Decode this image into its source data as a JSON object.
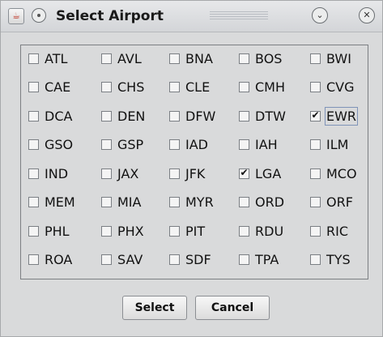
{
  "window": {
    "title": "Select Airport",
    "app_icon_glyph": "☕",
    "minimize_glyph": "⌄",
    "close_glyph": "✕"
  },
  "airports": [
    {
      "code": "ATL",
      "checked": false
    },
    {
      "code": "AVL",
      "checked": false
    },
    {
      "code": "BNA",
      "checked": false
    },
    {
      "code": "BOS",
      "checked": false
    },
    {
      "code": "BWI",
      "checked": false
    },
    {
      "code": "CAE",
      "checked": false
    },
    {
      "code": "CHS",
      "checked": false
    },
    {
      "code": "CLE",
      "checked": false
    },
    {
      "code": "CMH",
      "checked": false
    },
    {
      "code": "CVG",
      "checked": false
    },
    {
      "code": "DCA",
      "checked": false
    },
    {
      "code": "DEN",
      "checked": false
    },
    {
      "code": "DFW",
      "checked": false
    },
    {
      "code": "DTW",
      "checked": false
    },
    {
      "code": "EWR",
      "checked": true,
      "focused": true
    },
    {
      "code": "GSO",
      "checked": false
    },
    {
      "code": "GSP",
      "checked": false
    },
    {
      "code": "IAD",
      "checked": false
    },
    {
      "code": "IAH",
      "checked": false
    },
    {
      "code": "ILM",
      "checked": false
    },
    {
      "code": "IND",
      "checked": false
    },
    {
      "code": "JAX",
      "checked": false
    },
    {
      "code": "JFK",
      "checked": false
    },
    {
      "code": "LGA",
      "checked": true
    },
    {
      "code": "MCO",
      "checked": false
    },
    {
      "code": "MEM",
      "checked": false
    },
    {
      "code": "MIA",
      "checked": false
    },
    {
      "code": "MYR",
      "checked": false
    },
    {
      "code": "ORD",
      "checked": false
    },
    {
      "code": "ORF",
      "checked": false
    },
    {
      "code": "PHL",
      "checked": false
    },
    {
      "code": "PHX",
      "checked": false
    },
    {
      "code": "PIT",
      "checked": false
    },
    {
      "code": "RDU",
      "checked": false
    },
    {
      "code": "RIC",
      "checked": false
    },
    {
      "code": "ROA",
      "checked": false
    },
    {
      "code": "SAV",
      "checked": false
    },
    {
      "code": "SDF",
      "checked": false
    },
    {
      "code": "TPA",
      "checked": false
    },
    {
      "code": "TYS",
      "checked": false
    }
  ],
  "buttons": {
    "select_label": "Select",
    "cancel_label": "Cancel"
  },
  "icons": {
    "app": "java-app-icon",
    "window_menu": "window-menu-icon",
    "minimize": "chevron-down-icon",
    "close": "close-icon"
  }
}
